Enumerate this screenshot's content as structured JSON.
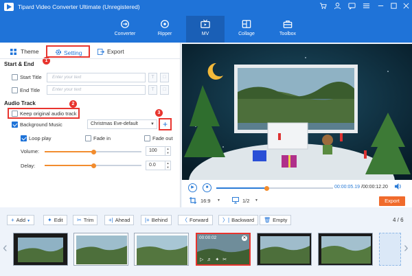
{
  "app": {
    "title": "Tipard Video Converter Ultimate (Unregistered)"
  },
  "titlebar_icons": [
    "cart-icon",
    "user-icon",
    "chat-icon",
    "menu-icon",
    "minimize-icon",
    "maximize-icon",
    "close-icon"
  ],
  "nav": {
    "tabs": [
      {
        "label": "Converter",
        "icon": "converter-icon"
      },
      {
        "label": "Ripper",
        "icon": "ripper-icon"
      },
      {
        "label": "MV",
        "icon": "mv-icon",
        "active": true
      },
      {
        "label": "Collage",
        "icon": "collage-icon"
      },
      {
        "label": "Toolbox",
        "icon": "toolbox-icon"
      }
    ]
  },
  "panel_tabs": {
    "theme": "Theme",
    "setting": "Setting",
    "export": "Export"
  },
  "badges": {
    "one": "1",
    "two": "2",
    "three": "3"
  },
  "start_end": {
    "heading": "Start & End",
    "start_title": {
      "label": "Start Title",
      "placeholder": "Enter your text",
      "checked": false
    },
    "end_title": {
      "label": "End Title",
      "placeholder": "Enter your text",
      "checked": false
    }
  },
  "audio": {
    "heading": "Audio Track",
    "keep_original": {
      "label": "Keep original audio track",
      "checked": false
    },
    "background_music": {
      "label": "Background Music",
      "checked": true,
      "value": "Christmas Eve-default"
    },
    "add_symbol": "+",
    "loop_play": {
      "label": "Loop play",
      "checked": true
    },
    "fade_in": {
      "label": "Fade in",
      "checked": false
    },
    "fade_out": {
      "label": "Fade out",
      "checked": false
    },
    "volume": {
      "label": "Volume:",
      "value": "100",
      "level": 0.5
    },
    "delay": {
      "label": "Delay:",
      "value": "0.0",
      "level": 0.5
    }
  },
  "player": {
    "time_current": "00:00:05.19",
    "time_total": "/00:00:12.20",
    "progress": 0.43,
    "aspect": "16:9",
    "page": "1/2",
    "export_label": "Export"
  },
  "toolbar": {
    "add": "Add",
    "edit": "Edit",
    "trim": "Trim",
    "ahead": "Ahead",
    "behind": "Behind",
    "forward": "Forward",
    "backward": "Backward",
    "empty": "Empty",
    "counter": "4 / 6"
  },
  "timeline": {
    "selected_time": "00:00:02",
    "clips": 6
  },
  "colors": {
    "brand_blue": "#1f73d8",
    "accent_orange": "#f06b2c",
    "highlight_red": "#e8342e"
  }
}
